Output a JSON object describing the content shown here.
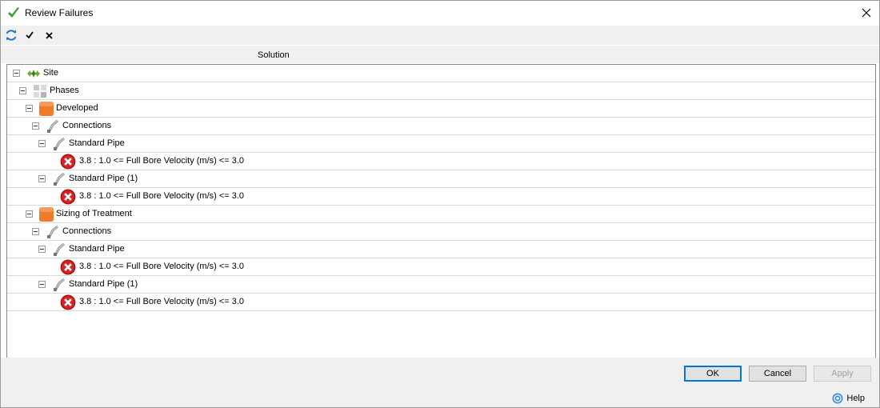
{
  "window": {
    "title": "Review Failures"
  },
  "toolbar": {
    "refresh_icon": "refresh-icon",
    "check_icon": "check-icon",
    "x_icon": "x-icon"
  },
  "column": {
    "header": "Solution"
  },
  "tree": [
    {
      "label": "Site",
      "icon": "site-icon",
      "level": 0,
      "expand": true
    },
    {
      "label": "Phases",
      "icon": "phases-icon",
      "level": 1,
      "expand": true
    },
    {
      "label": "Developed",
      "icon": "phase-icon",
      "level": 2,
      "expand": true
    },
    {
      "label": "Connections",
      "icon": "connection-icon",
      "level": 3,
      "expand": true
    },
    {
      "label": "Standard Pipe",
      "icon": "pipe-icon",
      "level": 4,
      "expand": true
    },
    {
      "label": "3.8 : 1.0 <= Full Bore Velocity (m/s) <= 3.0",
      "icon": "error-icon",
      "level": 5,
      "expand": false
    },
    {
      "label": "Standard Pipe (1)",
      "icon": "pipe-icon",
      "level": 4,
      "expand": true
    },
    {
      "label": "3.8 : 1.0 <= Full Bore Velocity (m/s) <= 3.0",
      "icon": "error-icon",
      "level": 5,
      "expand": false
    },
    {
      "label": "Sizing of Treatment",
      "icon": "phase-icon",
      "level": 2,
      "expand": true
    },
    {
      "label": "Connections",
      "icon": "connection-icon",
      "level": 3,
      "expand": true
    },
    {
      "label": "Standard Pipe",
      "icon": "pipe-icon",
      "level": 4,
      "expand": true
    },
    {
      "label": "3.8 : 1.0 <= Full Bore Velocity (m/s) <= 3.0",
      "icon": "error-icon",
      "level": 5,
      "expand": false
    },
    {
      "label": "Standard Pipe (1)",
      "icon": "pipe-icon",
      "level": 4,
      "expand": true
    },
    {
      "label": "3.8 : 1.0 <= Full Bore Velocity (m/s) <= 3.0",
      "icon": "error-icon",
      "level": 5,
      "expand": false
    }
  ],
  "buttons": {
    "ok": "OK",
    "cancel": "Cancel",
    "apply": "Apply"
  },
  "help": {
    "label": "Help"
  },
  "colors": {
    "phase": "#f07c2a",
    "error": "#b01515",
    "accent": "#0078d7"
  }
}
